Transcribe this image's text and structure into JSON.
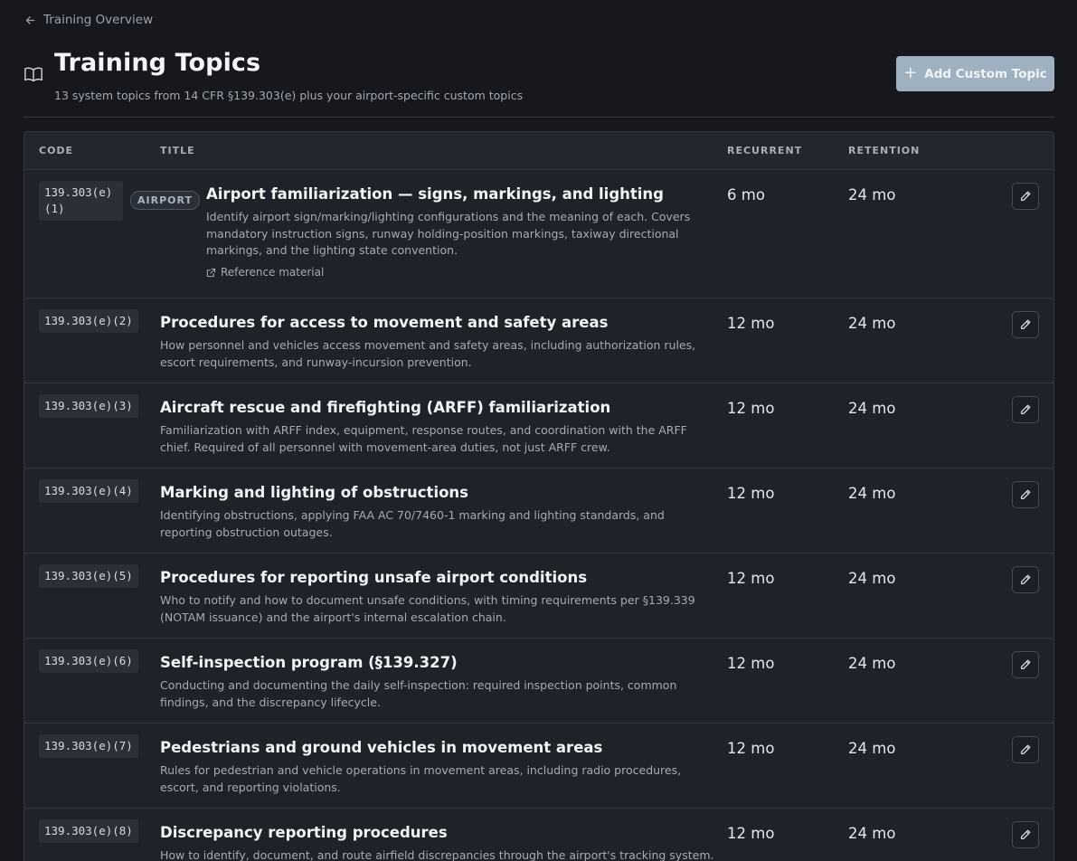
{
  "nav": {
    "back_label": "Training Overview"
  },
  "header": {
    "title": "Training Topics",
    "subtitle": "13 system topics from 14 CFR §139.303(e) plus your airport-specific custom topics",
    "add_button_label": "Add Custom Topic"
  },
  "table": {
    "columns": {
      "code": "CODE",
      "title": "TITLE",
      "recurrent": "RECURRENT",
      "retention": "RETENTION"
    },
    "rows": [
      {
        "code_line1": "139.303(e)",
        "code_line2": "(1)",
        "tag": "AIRPORT",
        "title": "Airport familiarization — signs, markings, and lighting",
        "description": "Identify airport sign/marking/lighting configurations and the meaning of each. Covers mandatory instruction signs, runway holding-position markings, taxiway directional markings, and the lighting state convention.",
        "reference_label": "Reference material",
        "recurrent": "6 mo",
        "retention": "24 mo"
      },
      {
        "code": "139.303(e)(2)",
        "title": "Procedures for access to movement and safety areas",
        "description": "How personnel and vehicles access movement and safety areas, including authorization rules, escort requirements, and runway-incursion prevention.",
        "recurrent": "12 mo",
        "retention": "24 mo"
      },
      {
        "code": "139.303(e)(3)",
        "title": "Aircraft rescue and firefighting (ARFF) familiarization",
        "description": "Familiarization with ARFF index, equipment, response routes, and coordination with the ARFF chief. Required of all personnel with movement-area duties, not just ARFF crew.",
        "recurrent": "12 mo",
        "retention": "24 mo"
      },
      {
        "code": "139.303(e)(4)",
        "title": "Marking and lighting of obstructions",
        "description": "Identifying obstructions, applying FAA AC 70/7460-1 marking and lighting standards, and reporting obstruction outages.",
        "recurrent": "12 mo",
        "retention": "24 mo"
      },
      {
        "code": "139.303(e)(5)",
        "title": "Procedures for reporting unsafe airport conditions",
        "description": "Who to notify and how to document unsafe conditions, with timing requirements per §139.339 (NOTAM issuance) and the airport's internal escalation chain.",
        "recurrent": "12 mo",
        "retention": "24 mo"
      },
      {
        "code": "139.303(e)(6)",
        "title": "Self-inspection program (§139.327)",
        "description": "Conducting and documenting the daily self-inspection: required inspection points, common findings, and the discrepancy lifecycle.",
        "recurrent": "12 mo",
        "retention": "24 mo"
      },
      {
        "code": "139.303(e)(7)",
        "title": "Pedestrians and ground vehicles in movement areas",
        "description": "Rules for pedestrian and vehicle operations in movement areas, including radio procedures, escort, and reporting violations.",
        "recurrent": "12 mo",
        "retention": "24 mo"
      },
      {
        "code": "139.303(e)(8)",
        "title": "Discrepancy reporting procedures",
        "description": "How to identify, document, and route airfield discrepancies through the airport's tracking system.",
        "recurrent": "12 mo",
        "retention": "24 mo"
      }
    ]
  },
  "colors": {
    "background": "#16181d",
    "primary_button": "#9fb0c0",
    "row_bg": "#1f2229"
  },
  "icons": {
    "back": "arrow-left-icon",
    "page": "book-open-icon",
    "add": "plus-icon",
    "edit": "pencil-icon",
    "external": "external-link-icon"
  }
}
